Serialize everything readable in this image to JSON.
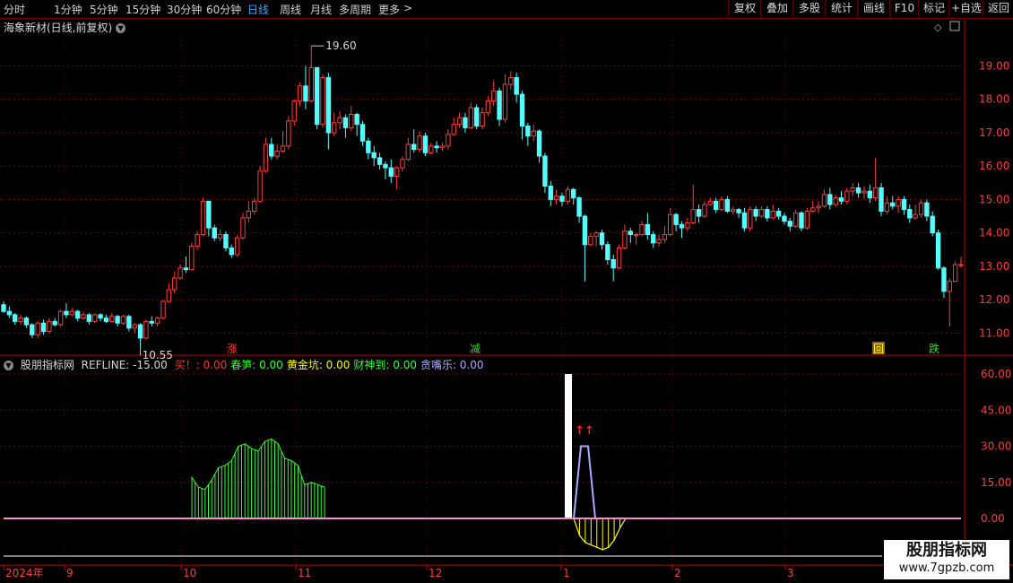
{
  "toolbar": {
    "periods": [
      "分时",
      "1分钟",
      "5分钟",
      "15分钟",
      "30分钟",
      "60分钟",
      "日线",
      "周线",
      "月线",
      "多周期",
      "更多"
    ],
    "active_period": "日线",
    "more_arrow": ">",
    "right_buttons": [
      "复权",
      "叠加",
      "多股",
      "统计",
      "画线",
      "F10",
      "标记",
      "+自选",
      "返回"
    ]
  },
  "main_chart": {
    "stock_title": "海象新材(日线,前复权)",
    "y_ticks": [
      "19.00",
      "18.00",
      "17.00",
      "16.00",
      "15.00",
      "14.00",
      "13.00",
      "12.00",
      "11.00"
    ],
    "high_label": "19.60",
    "low_label": "10.55",
    "markers": [
      {
        "text": "涨",
        "color": "#ff3333",
        "bg": "#000000"
      },
      {
        "text": "减",
        "color": "#33dd33",
        "bg": "#000000"
      },
      {
        "text": "回",
        "color": "#ffff00",
        "bg": "#886600"
      },
      {
        "text": "跌",
        "color": "#33dd33",
        "bg": "#000000"
      }
    ],
    "colors": {
      "up": "#ff3c3c",
      "down": "#54fcfc",
      "grid": "#7a0000",
      "axis": "#c00000"
    }
  },
  "indicator": {
    "name": "股朋指标网",
    "refline_label": "REFLINE: -15.00",
    "fields": [
      {
        "label": "买！: 0.00",
        "color": "#ff3333"
      },
      {
        "label": "春笋: 0.00",
        "color": "#33ff33"
      },
      {
        "label": "黄金坑: 0.00",
        "color": "#ffff00"
      },
      {
        "label": "财神到: 0.00",
        "color": "#33ff33"
      },
      {
        "label": "贪嘴乐: 0.00",
        "color": "#aaaaff"
      }
    ],
    "y_ticks": [
      "60.00",
      "45.00",
      "30.00",
      "15.00",
      "0.00"
    ],
    "arrow_label": "↑↑"
  },
  "x_axis": {
    "labels": [
      "2024年",
      "9",
      "10",
      "11",
      "12",
      "1",
      "2",
      "3"
    ]
  },
  "watermark": {
    "line1": "股朋指标网",
    "line2": "www.7gpzb.com"
  },
  "chart_data": {
    "type": "candlestick",
    "title": "海象新材(日线,前复权)",
    "ylim": [
      10.5,
      19.9
    ],
    "candles": [
      [
        11.85,
        11.65,
        11.95,
        11.6
      ],
      [
        11.65,
        11.55,
        11.8,
        11.45
      ],
      [
        11.55,
        11.35,
        11.6,
        11.25
      ],
      [
        11.35,
        11.45,
        11.55,
        11.25
      ],
      [
        11.45,
        11.25,
        11.5,
        11.15
      ],
      [
        11.25,
        10.95,
        11.3,
        10.85
      ],
      [
        10.95,
        11.3,
        11.35,
        10.85
      ],
      [
        11.3,
        11.05,
        11.4,
        10.95
      ],
      [
        11.05,
        11.35,
        11.45,
        11.0
      ],
      [
        11.35,
        11.25,
        11.45,
        11.2
      ],
      [
        11.25,
        11.65,
        11.7,
        11.2
      ],
      [
        11.65,
        11.55,
        11.9,
        11.45
      ],
      [
        11.55,
        11.65,
        11.75,
        11.5
      ],
      [
        11.65,
        11.45,
        11.7,
        11.35
      ],
      [
        11.45,
        11.55,
        11.65,
        11.4
      ],
      [
        11.55,
        11.35,
        11.6,
        11.25
      ],
      [
        11.35,
        11.55,
        11.6,
        11.3
      ],
      [
        11.55,
        11.45,
        11.6,
        11.35
      ],
      [
        11.45,
        11.35,
        11.55,
        11.3
      ],
      [
        11.35,
        11.5,
        11.6,
        11.3
      ],
      [
        11.5,
        11.3,
        11.55,
        11.2
      ],
      [
        11.3,
        11.5,
        11.55,
        11.25
      ],
      [
        11.5,
        11.15,
        11.55,
        11.05
      ],
      [
        11.15,
        11.25,
        11.3,
        11.0
      ],
      [
        11.25,
        10.85,
        11.3,
        10.55
      ],
      [
        10.85,
        11.35,
        11.4,
        10.8
      ],
      [
        11.35,
        11.3,
        11.5,
        11.2
      ],
      [
        11.3,
        11.45,
        11.5,
        11.2
      ],
      [
        11.45,
        11.95,
        12.0,
        11.4
      ],
      [
        11.95,
        12.3,
        12.5,
        11.9
      ],
      [
        12.3,
        12.65,
        12.85,
        12.2
      ],
      [
        12.65,
        12.95,
        13.05,
        12.6
      ],
      [
        12.95,
        12.9,
        13.3,
        12.8
      ],
      [
        12.9,
        13.6,
        13.7,
        12.9
      ],
      [
        13.6,
        13.95,
        14.05,
        13.5
      ],
      [
        13.95,
        14.95,
        15.05,
        13.9
      ],
      [
        14.95,
        14.15,
        14.95,
        13.9
      ],
      [
        14.15,
        13.85,
        14.25,
        13.75
      ],
      [
        13.85,
        13.95,
        14.1,
        13.75
      ],
      [
        13.95,
        13.55,
        14.05,
        13.45
      ],
      [
        13.55,
        13.35,
        13.65,
        13.25
      ],
      [
        13.35,
        13.85,
        13.95,
        13.3
      ],
      [
        13.85,
        14.45,
        14.6,
        13.8
      ],
      [
        14.45,
        14.65,
        14.95,
        14.3
      ],
      [
        14.65,
        14.95,
        15.05,
        14.55
      ],
      [
        14.95,
        15.85,
        16.0,
        14.9
      ],
      [
        15.85,
        16.65,
        16.85,
        15.8
      ],
      [
        16.65,
        16.3,
        16.85,
        16.2
      ],
      [
        16.3,
        16.45,
        16.65,
        16.2
      ],
      [
        16.45,
        16.6,
        17.05,
        16.4
      ],
      [
        16.6,
        17.35,
        17.5,
        16.5
      ],
      [
        17.35,
        17.95,
        18.0,
        17.2
      ],
      [
        17.95,
        18.4,
        18.5,
        17.8
      ],
      [
        18.4,
        17.95,
        19.0,
        17.7
      ],
      [
        17.95,
        18.95,
        19.6,
        17.9
      ],
      [
        18.95,
        17.25,
        18.95,
        17.1
      ],
      [
        17.25,
        18.65,
        18.75,
        17.15
      ],
      [
        18.65,
        17.0,
        18.8,
        16.5
      ],
      [
        17.0,
        17.3,
        17.6,
        16.9
      ],
      [
        17.3,
        17.45,
        17.65,
        17.1
      ],
      [
        17.45,
        17.15,
        17.55,
        16.85
      ],
      [
        17.15,
        17.55,
        17.8,
        17.05
      ],
      [
        17.55,
        17.25,
        17.6,
        16.9
      ],
      [
        17.25,
        16.75,
        17.35,
        16.6
      ],
      [
        16.75,
        16.4,
        16.85,
        16.2
      ],
      [
        16.4,
        16.25,
        16.6,
        16.0
      ],
      [
        16.25,
        16.05,
        16.4,
        15.9
      ],
      [
        16.05,
        15.95,
        16.15,
        15.6
      ],
      [
        15.95,
        15.7,
        16.2,
        15.5
      ],
      [
        15.7,
        15.95,
        16.0,
        15.3
      ],
      [
        15.95,
        16.2,
        16.3,
        15.85
      ],
      [
        16.2,
        16.65,
        16.85,
        16.15
      ],
      [
        16.65,
        16.5,
        17.1,
        16.4
      ],
      [
        16.5,
        16.9,
        17.05,
        16.4
      ],
      [
        16.9,
        16.4,
        17.0,
        16.3
      ],
      [
        16.4,
        16.6,
        16.7,
        16.35
      ],
      [
        16.6,
        16.55,
        16.75,
        16.4
      ],
      [
        16.55,
        16.6,
        16.7,
        16.45
      ],
      [
        16.6,
        16.95,
        17.1,
        16.5
      ],
      [
        16.95,
        17.25,
        17.45,
        16.9
      ],
      [
        17.25,
        17.45,
        17.6,
        17.15
      ],
      [
        17.45,
        17.15,
        17.6,
        17.0
      ],
      [
        17.15,
        17.75,
        17.9,
        17.1
      ],
      [
        17.75,
        17.2,
        17.85,
        17.1
      ],
      [
        17.2,
        17.6,
        17.75,
        17.1
      ],
      [
        17.6,
        17.95,
        18.1,
        17.5
      ],
      [
        17.95,
        18.25,
        18.55,
        17.8
      ],
      [
        18.25,
        17.4,
        18.35,
        17.2
      ],
      [
        17.4,
        18.45,
        18.75,
        17.3
      ],
      [
        18.45,
        18.65,
        18.85,
        18.3
      ],
      [
        18.65,
        18.15,
        18.8,
        17.9
      ],
      [
        18.15,
        17.2,
        18.25,
        16.8
      ],
      [
        17.2,
        16.9,
        17.3,
        16.6
      ],
      [
        16.9,
        17.05,
        17.25,
        16.75
      ],
      [
        17.05,
        16.3,
        17.1,
        16.1
      ],
      [
        16.3,
        15.4,
        16.4,
        15.2
      ],
      [
        15.4,
        15.0,
        15.55,
        14.8
      ],
      [
        15.0,
        15.1,
        15.3,
        14.85
      ],
      [
        15.1,
        14.95,
        15.2,
        14.8
      ],
      [
        14.95,
        15.3,
        15.4,
        14.85
      ],
      [
        15.3,
        15.05,
        15.35,
        14.85
      ],
      [
        15.05,
        14.5,
        15.1,
        14.3
      ],
      [
        14.5,
        13.65,
        14.55,
        12.55
      ],
      [
        13.65,
        13.9,
        14.0,
        13.6
      ],
      [
        13.9,
        14.0,
        14.05,
        13.6
      ],
      [
        14.0,
        13.65,
        14.1,
        13.5
      ],
      [
        13.65,
        13.2,
        13.75,
        13.05
      ],
      [
        13.2,
        12.95,
        13.35,
        12.55
      ],
      [
        12.95,
        13.55,
        13.65,
        12.9
      ],
      [
        13.55,
        14.05,
        14.25,
        13.5
      ],
      [
        14.05,
        13.95,
        14.15,
        13.7
      ],
      [
        13.95,
        13.95,
        14.0,
        13.65
      ],
      [
        13.95,
        14.25,
        14.35,
        13.9
      ],
      [
        14.25,
        13.95,
        14.6,
        13.8
      ],
      [
        13.95,
        13.7,
        14.05,
        13.55
      ],
      [
        13.7,
        13.8,
        13.95,
        13.6
      ],
      [
        13.8,
        13.95,
        14.2,
        13.7
      ],
      [
        13.95,
        14.55,
        14.75,
        13.9
      ],
      [
        14.55,
        14.25,
        14.6,
        14.05
      ],
      [
        14.25,
        14.15,
        14.35,
        13.85
      ],
      [
        14.15,
        14.3,
        14.45,
        14.05
      ],
      [
        14.3,
        14.7,
        15.45,
        14.25
      ],
      [
        14.7,
        14.5,
        14.85,
        14.3
      ],
      [
        14.5,
        14.85,
        14.95,
        14.45
      ],
      [
        14.85,
        14.95,
        15.05,
        14.8
      ],
      [
        14.95,
        14.7,
        15.05,
        14.6
      ],
      [
        14.7,
        15.0,
        15.1,
        14.65
      ],
      [
        15.0,
        14.65,
        15.1,
        14.6
      ],
      [
        14.65,
        14.7,
        14.8,
        14.55
      ],
      [
        14.7,
        14.6,
        14.75,
        14.45
      ],
      [
        14.6,
        14.15,
        14.75,
        14.05
      ],
      [
        14.15,
        14.7,
        14.8,
        14.05
      ],
      [
        14.7,
        14.5,
        14.8,
        14.35
      ],
      [
        14.5,
        14.7,
        14.8,
        14.45
      ],
      [
        14.7,
        14.45,
        14.8,
        14.35
      ],
      [
        14.45,
        14.65,
        14.85,
        14.4
      ],
      [
        14.65,
        14.5,
        14.75,
        14.4
      ],
      [
        14.5,
        14.35,
        14.6,
        14.25
      ],
      [
        14.35,
        14.2,
        14.45,
        14.05
      ],
      [
        14.2,
        14.6,
        14.7,
        14.15
      ],
      [
        14.6,
        14.15,
        14.65,
        14.05
      ],
      [
        14.15,
        14.65,
        14.75,
        14.1
      ],
      [
        14.65,
        14.75,
        14.95,
        14.6
      ],
      [
        14.75,
        14.8,
        14.95,
        14.6
      ],
      [
        14.8,
        15.15,
        15.3,
        14.75
      ],
      [
        15.15,
        14.85,
        15.35,
        14.7
      ],
      [
        14.85,
        15.05,
        15.15,
        14.8
      ],
      [
        15.05,
        14.95,
        15.25,
        14.85
      ],
      [
        14.95,
        15.25,
        15.35,
        14.85
      ],
      [
        15.25,
        15.35,
        15.5,
        15.1
      ],
      [
        15.35,
        15.2,
        15.5,
        15.05
      ],
      [
        15.2,
        15.25,
        15.4,
        15.0
      ],
      [
        15.25,
        15.05,
        15.45,
        14.9
      ],
      [
        15.05,
        15.35,
        16.25,
        14.95
      ],
      [
        15.35,
        14.65,
        15.5,
        14.5
      ],
      [
        14.65,
        14.9,
        15.1,
        14.55
      ],
      [
        14.9,
        14.8,
        15.1,
        14.7
      ],
      [
        14.8,
        15.0,
        15.1,
        14.6
      ],
      [
        15.0,
        14.7,
        15.1,
        14.55
      ],
      [
        14.7,
        14.45,
        14.85,
        14.3
      ],
      [
        14.45,
        14.55,
        14.85,
        14.4
      ],
      [
        14.55,
        14.9,
        15.0,
        14.45
      ],
      [
        14.9,
        14.5,
        15.0,
        14.35
      ],
      [
        14.5,
        14.0,
        14.65,
        13.9
      ],
      [
        14.0,
        12.95,
        14.1,
        12.9
      ],
      [
        12.95,
        12.25,
        13.0,
        12.05
      ],
      [
        12.25,
        12.55,
        12.65,
        11.2
      ],
      [
        12.55,
        13.05,
        13.15,
        12.55
      ],
      [
        13.05,
        13.05,
        13.3,
        12.95
      ]
    ],
    "indicator_series": {
      "green_band": [
        17,
        13,
        12,
        16,
        21,
        22,
        24,
        30,
        31,
        29,
        28,
        32,
        33,
        31,
        25,
        24,
        22,
        14,
        15,
        14,
        13
      ],
      "white_bar": 60,
      "lilac_peak": 30,
      "yellow_band_min": -13
    }
  }
}
